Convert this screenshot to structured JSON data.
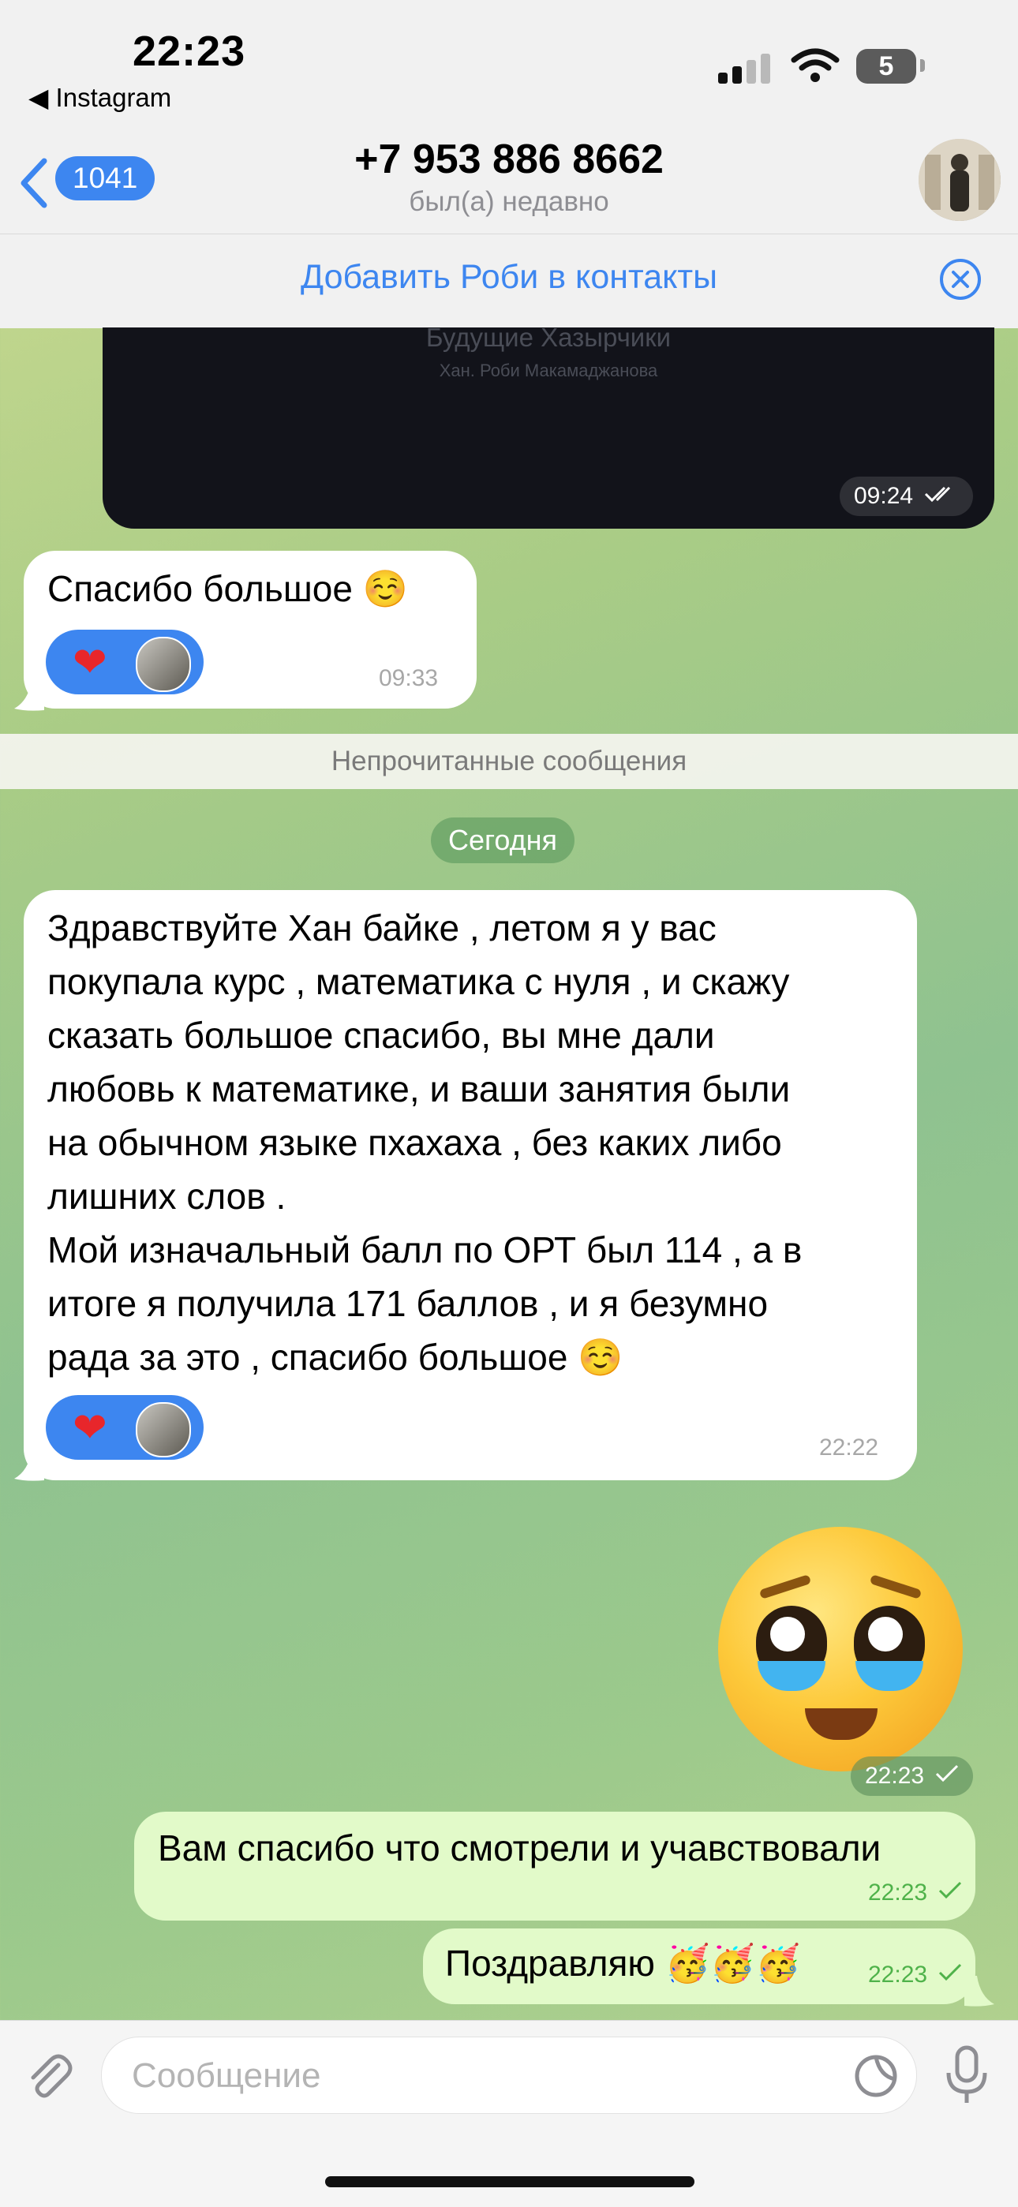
{
  "status_bar": {
    "time": "22:23",
    "back_app": "◀ Instagram",
    "battery": "5"
  },
  "header": {
    "unread_count": "1041",
    "contact_name": "+7 953 886 8662",
    "contact_status": "был(а) недавно",
    "add_contact_text": "Добавить Роби в контакты"
  },
  "media_message": {
    "ghost_title": "Будущие Хазырчики",
    "ghost_subtitle": "Хан. Роби Макамаджанова",
    "time": "09:24"
  },
  "messages": {
    "m1": {
      "text": "Спасибо большое ☺️",
      "time": "09:33"
    },
    "unread_label": "Непрочитанные сообщения",
    "date_label": "Сегодня",
    "m2": {
      "text": "Здравствуйте Хан байке , летом я у вас\nпокупала курс , математика с нуля , и скажу\nсказать большое спасибо, вы мне дали\nлюбовь к математике, и ваши занятия были\nна обычном языке пхахаха , без каких либо\nлишних слов .\nМой изначальный балл по ОРТ был 114 , а в\nитоге я получила 171 баллов , и я безумно\nрада за это , спасибо большое ☺️",
      "time": "22:22"
    },
    "emoji_time": "22:23",
    "m3": {
      "text": "Вам спасибо что смотрели и учавствовали",
      "time": "22:23"
    },
    "m4": {
      "text": "Поздравляю 🥳🥳🥳",
      "time": "22:23"
    }
  },
  "reactions": {
    "heart": "❤"
  },
  "input": {
    "placeholder": "Сообщение"
  },
  "colors": {
    "accent": "#3d86f0",
    "outgoing_bubble": "#e2fac9",
    "outgoing_time": "#4fb24a"
  }
}
